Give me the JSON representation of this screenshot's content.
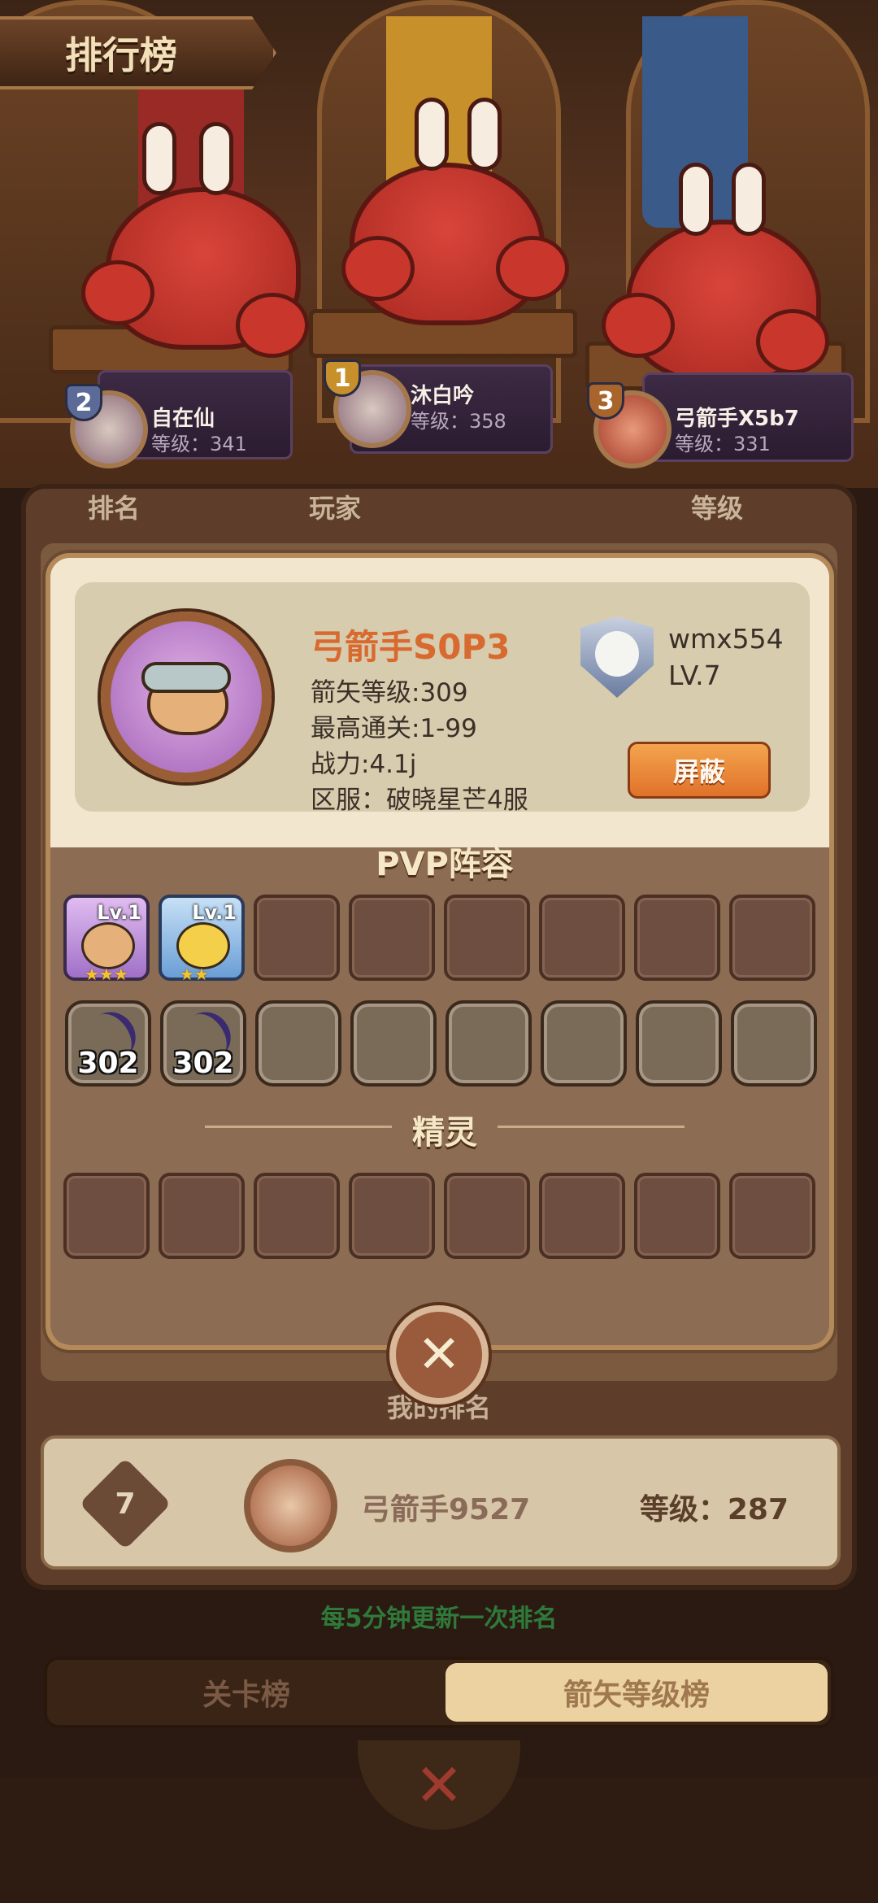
{
  "header": {
    "title": "排行榜"
  },
  "podium": [
    {
      "rank": "2",
      "name": "自在仙",
      "level": "等级：341"
    },
    {
      "rank": "1",
      "name": "沐白吟",
      "level": "等级：358"
    },
    {
      "rank": "3",
      "name": "弓箭手X5b7",
      "level": "等级：331"
    }
  ],
  "columns": {
    "rank": "排名",
    "player": "玩家",
    "level": "等级"
  },
  "modal": {
    "player_name": "弓箭手S0P3",
    "arrow_level": "箭矢等级:309",
    "max_stage": "最高通关:1-99",
    "power": "战力:4.1j",
    "server": "区服：破晓星芒4服",
    "guild_name": "wmx554",
    "guild_level": "LV.7",
    "block_label": "屏蔽",
    "pvp_title": "PVP阵容",
    "spirit_title": "精灵",
    "heroes": [
      {
        "level": "Lv.1",
        "stars": "★★★",
        "icon": "fox-archer-icon"
      },
      {
        "level": "Lv.1",
        "stars": "★★",
        "icon": "duck-archer-icon"
      }
    ],
    "weapons": [
      {
        "value": "302",
        "icon": "bow-icon"
      },
      {
        "value": "302",
        "icon": "bow-icon"
      }
    ],
    "close_icon": "close-icon"
  },
  "my_rank": {
    "title": "我的排名",
    "rank": "7",
    "name": "弓箭手9527",
    "level": "等级：287"
  },
  "update_note": "每5分钟更新一次排名",
  "tabs": {
    "stage": "关卡榜",
    "arrow": "箭矢等级榜"
  },
  "colors": {
    "accent": "#e0722a",
    "name": "#d86a30",
    "note": "#2f7a3a"
  }
}
